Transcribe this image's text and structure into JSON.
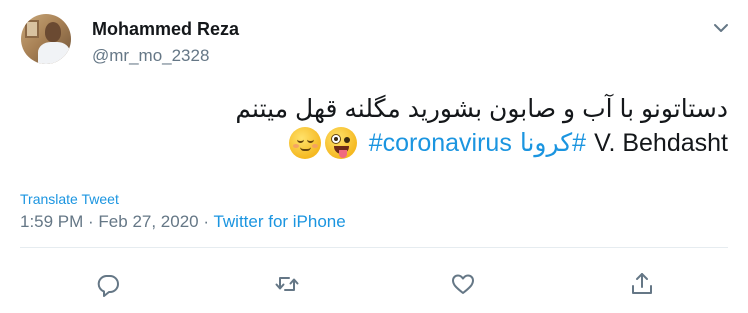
{
  "user": {
    "name": "Mohammed Reza",
    "handle": "@mr_mo_2328"
  },
  "tweet": {
    "line1": "دستاتونو با آب و صابون بشورید مگلنه قهل میتنم",
    "line2_prefix": "V. Behdasht",
    "hashtag1": "#کرونا",
    "hashtag2": "#coronavirus",
    "emojis": [
      "zany-face-emoji",
      "relieved-face-emoji"
    ]
  },
  "translate_label": "Translate Tweet",
  "meta": {
    "time": "1:59 PM",
    "sep1": " · ",
    "date": "Feb 27, 2020",
    "sep2": " · ",
    "source": "Twitter for iPhone"
  },
  "actions": [
    "reply-icon",
    "retweet-icon",
    "like-icon",
    "share-icon"
  ],
  "colors": {
    "link": "#1b95e0",
    "secondary_text": "#657786",
    "primary_text": "#14171a",
    "divider": "#e6ecf0"
  }
}
